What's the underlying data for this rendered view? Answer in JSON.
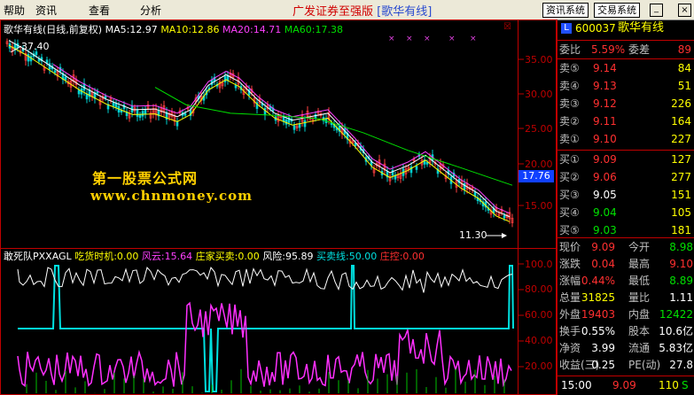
{
  "menubar": {
    "items": [
      "帮助",
      "资讯",
      "查看",
      "分析"
    ],
    "title": "广发证券至强版",
    "title_sub": "[歌华有线]",
    "btn_news": "资讯系统",
    "btn_trade": "交易系统"
  },
  "chart_header": {
    "name": "歌华有线(日线,前复权)",
    "ma5": "MA5:12.97",
    "ma10": "MA10:12.86",
    "ma20": "MA20:14.71",
    "ma60": "MA60:17.38"
  },
  "price_axis": {
    "ticks": [
      "35.00",
      "30.00",
      "25.00",
      "20.00",
      "15.00"
    ],
    "current": "17.76"
  },
  "annotations": {
    "high": "37.40",
    "low": "11.30"
  },
  "watermark": {
    "line1": "第一股票公式网",
    "line2": "www.chnmoney.com"
  },
  "indicator_header": {
    "name": "敢死队PXXAGL",
    "chd": "吃货时机:0.00",
    "fy": "风云:15.64",
    "zj": "庄家买卖:0.00",
    "fx": "风险:95.89",
    "mm": "买卖线:50.00",
    "zk": "庄控:0.00"
  },
  "indicator_axis": {
    "ticks": [
      "100.0",
      "80.00",
      "60.00",
      "40.00",
      "20.00"
    ]
  },
  "quote": {
    "code": "600037",
    "name": "歌华有线",
    "webi_label": "委比",
    "webi": "5.59%",
    "weicha_label": "委差",
    "weicha": "89",
    "sell": [
      {
        "label": "卖⑤",
        "price": "9.14",
        "vol": "84"
      },
      {
        "label": "卖④",
        "price": "9.13",
        "vol": "51"
      },
      {
        "label": "卖③",
        "price": "9.12",
        "vol": "226"
      },
      {
        "label": "卖②",
        "price": "9.11",
        "vol": "164"
      },
      {
        "label": "卖①",
        "price": "9.10",
        "vol": "227"
      }
    ],
    "buy": [
      {
        "label": "买①",
        "price": "9.09",
        "vol": "127"
      },
      {
        "label": "买②",
        "price": "9.06",
        "vol": "277"
      },
      {
        "label": "买③",
        "price": "9.05",
        "vol": "151"
      },
      {
        "label": "买④",
        "price": "9.04",
        "vol": "105"
      },
      {
        "label": "买⑤",
        "price": "9.03",
        "vol": "181"
      }
    ],
    "stats": [
      {
        "l1": "现价",
        "v1": "9.09",
        "c1": "red",
        "l2": "今开",
        "v2": "8.98",
        "c2": "green"
      },
      {
        "l1": "涨跌",
        "v1": "0.04",
        "c1": "red",
        "l2": "最高",
        "v2": "9.10",
        "c2": "red"
      },
      {
        "l1": "涨幅",
        "v1": "0.44%",
        "c1": "red",
        "l2": "最低",
        "v2": "8.89",
        "c2": "green"
      },
      {
        "l1": "总量",
        "v1": "31825",
        "c1": "yellow",
        "l2": "量比",
        "v2": "1.11",
        "c2": "white"
      },
      {
        "l1": "外盘",
        "v1": "19403",
        "c1": "red",
        "l2": "内盘",
        "v2": "12422",
        "c2": "green"
      },
      {
        "l1": "换手",
        "v1": "0.55%",
        "c1": "white",
        "l2": "股本",
        "v2": "10.6亿",
        "c2": "white"
      },
      {
        "l1": "净资",
        "v1": "3.99",
        "c1": "white",
        "l2": "流通",
        "v2": "5.83亿",
        "c2": "white"
      },
      {
        "l1": "收益(三)",
        "v1": "0.25",
        "c1": "white",
        "l2": "PE(动)",
        "v2": "27.8",
        "c2": "white"
      }
    ],
    "tick_time": "15:00",
    "tick_price": "9.09",
    "tick_vol": "110",
    "tick_flag": "S"
  }
}
